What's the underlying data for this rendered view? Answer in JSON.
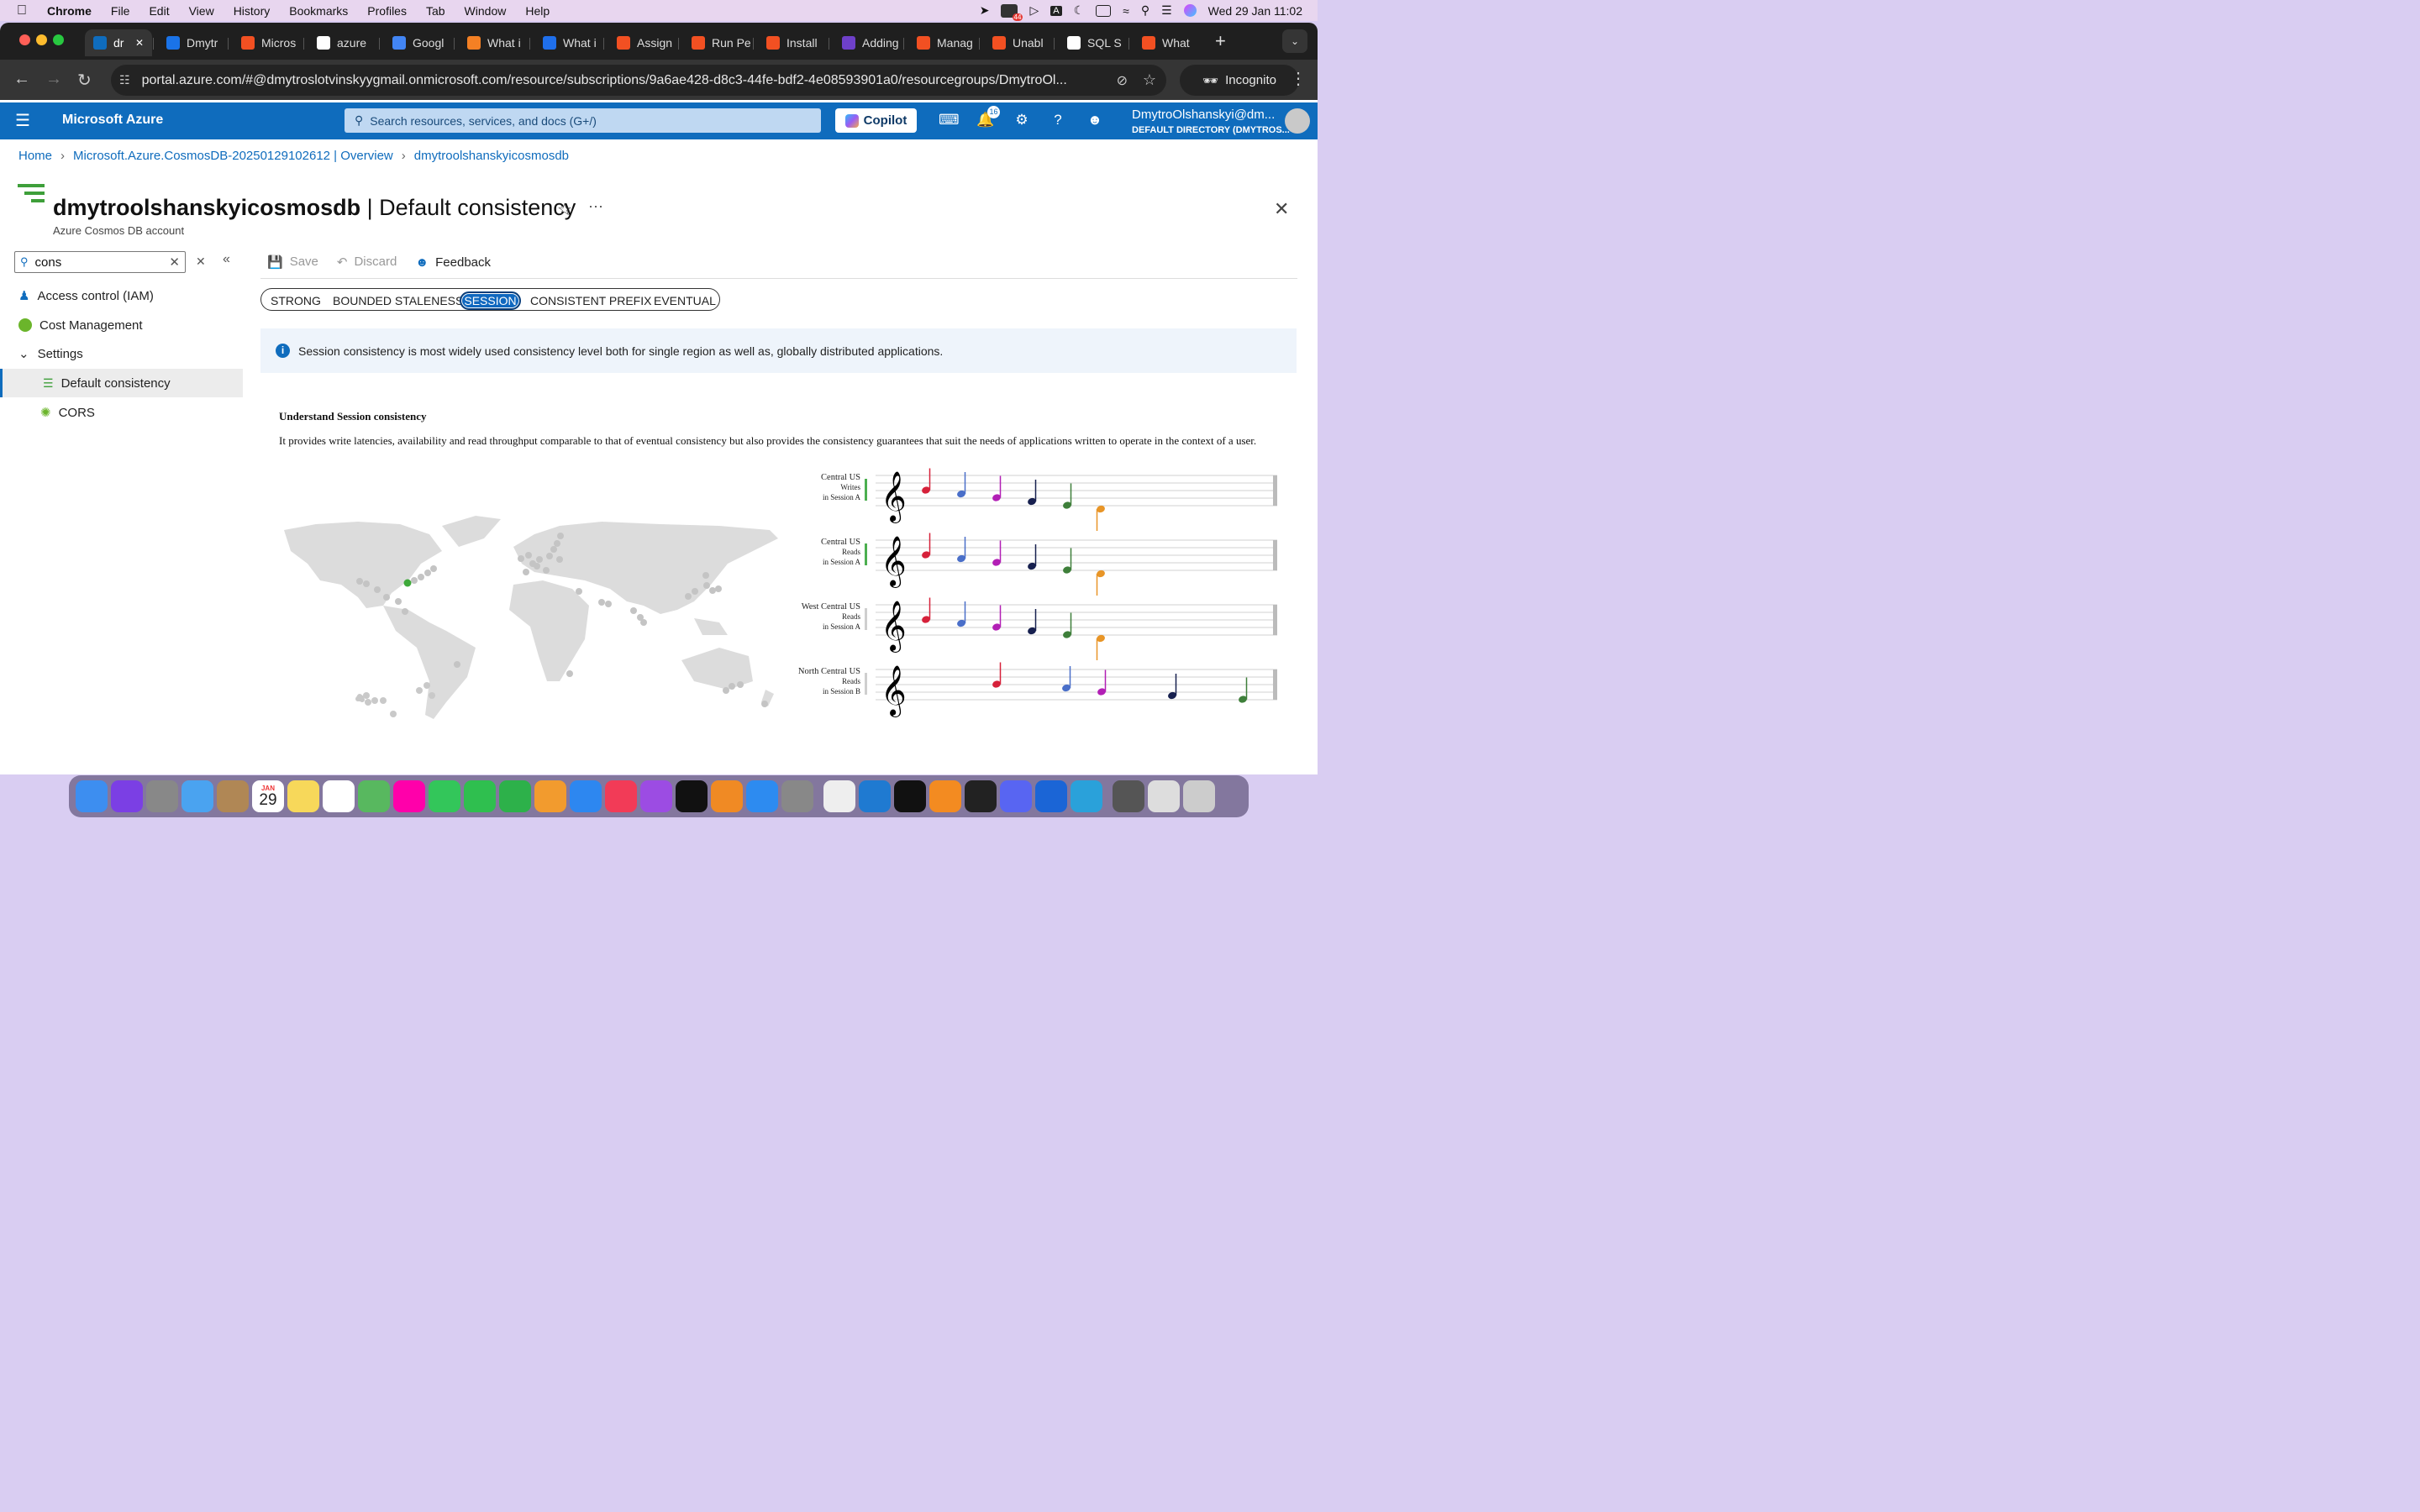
{
  "menubar": {
    "app": "Chrome",
    "items": [
      "File",
      "Edit",
      "View",
      "History",
      "Bookmarks",
      "Profiles",
      "Tab",
      "Window",
      "Help"
    ],
    "clock": "Wed 29 Jan  11:02",
    "badge": "44"
  },
  "tabs": [
    {
      "label": "dr",
      "color": "#0f6cbd",
      "active": true
    },
    {
      "label": "Dmytr",
      "color": "#1a73e8"
    },
    {
      "label": "Micros",
      "color": "#f25022"
    },
    {
      "label": "azure",
      "color": "#ffffff"
    },
    {
      "label": "Googl",
      "color": "#4285f4"
    },
    {
      "label": "What i",
      "color": "#f48024"
    },
    {
      "label": "What i",
      "color": "#1f6feb"
    },
    {
      "label": "Assign",
      "color": "#f25022"
    },
    {
      "label": "Run Pe",
      "color": "#f25022"
    },
    {
      "label": "Install",
      "color": "#f25022"
    },
    {
      "label": "Adding",
      "color": "#6e40c9"
    },
    {
      "label": "Manag",
      "color": "#f25022"
    },
    {
      "label": "Unabl",
      "color": "#f25022"
    },
    {
      "label": "SQL S",
      "color": "#ffffff"
    },
    {
      "label": "What",
      "color": "#f25022"
    }
  ],
  "address": {
    "url": "portal.azure.com/#@dmytroslotvinskyygmail.onmicrosoft.com/resource/subscriptions/9a6ae428-d8c3-44fe-bdf2-4e08593901a0/resourcegroups/DmytroOl...",
    "incognito": "Incognito"
  },
  "azure": {
    "brand": "Microsoft Azure",
    "search_placeholder": "Search resources, services, and docs (G+/)",
    "copilot": "Copilot",
    "notif_count": "16",
    "user_name": "DmytroOlshanskyi@dm...",
    "user_dir": "DEFAULT DIRECTORY (DMYTROS..."
  },
  "breadcrumb": [
    "Home",
    "Microsoft.Azure.CosmosDB-20250129102612 | Overview",
    "dmytroolshanskyicosmosdb"
  ],
  "page": {
    "title": "dmytroolshanskyicosmosdb",
    "title_suffix": "| Default consistency",
    "subtitle": "Azure Cosmos DB account"
  },
  "sidebar": {
    "search_value": "cons",
    "items": [
      {
        "label": "Access control (IAM)",
        "icon": "people-icon"
      },
      {
        "label": "Cost Management",
        "icon": "cost-icon"
      },
      {
        "label": "Settings",
        "icon": "chevron-down-icon"
      },
      {
        "label": "Default consistency",
        "icon": "consistency-icon",
        "selected": true
      },
      {
        "label": "CORS",
        "icon": "cors-icon"
      }
    ]
  },
  "toolbar": {
    "save": "Save",
    "discard": "Discard",
    "feedback": "Feedback"
  },
  "consistency_levels": [
    "STRONG",
    "BOUNDED STALENESS",
    "SESSION",
    "CONSISTENT PREFIX",
    "EVENTUAL"
  ],
  "selected_level": "SESSION",
  "info": "Session consistency is most widely used consistency level both for single region as well as, globally distributed applications.",
  "understand": {
    "heading": "Understand Session consistency",
    "body": "It provides write latencies, availability and read throughput comparable to that of eventual consistency but also provides the consistency guarantees that suit the needs of applications written to operate in the context of a user."
  },
  "staves": [
    {
      "region": "Central US",
      "op": "Writes",
      "session": "in Session A",
      "bar": "#4caf50"
    },
    {
      "region": "Central US",
      "op": "Reads",
      "session": "in Session A",
      "bar": "#4caf50"
    },
    {
      "region": "West Central US",
      "op": "Reads",
      "session": "in Session A",
      "bar": "#cfcfcf"
    },
    {
      "region": "North Central US",
      "op": "Reads",
      "session": "in Session B",
      "bar": "#cfcfcf"
    }
  ],
  "note_colors": [
    "#d6213a",
    "#4a6fc9",
    "#b21fb5",
    "#17204f",
    "#3e7f3a",
    "#e89527"
  ],
  "dock_calendar": {
    "month": "JAN",
    "day": "29"
  }
}
